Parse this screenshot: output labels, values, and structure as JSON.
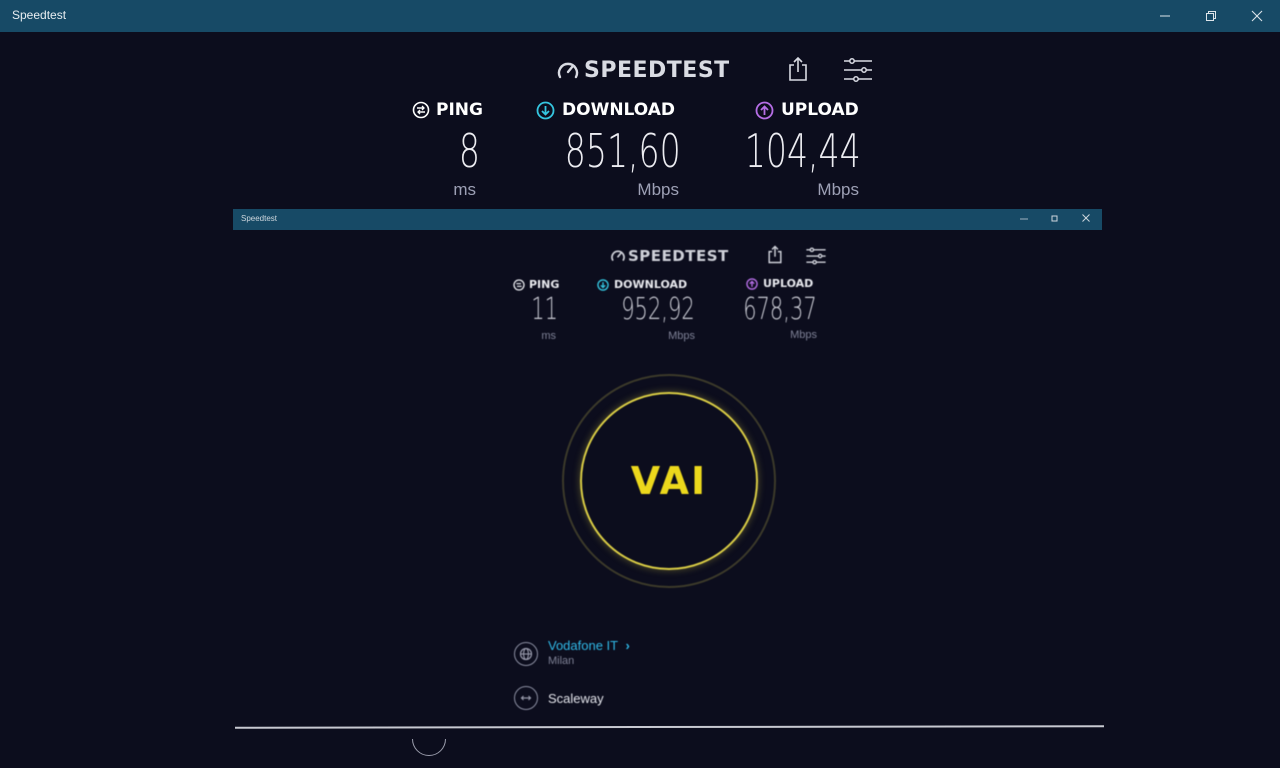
{
  "window": {
    "title": "Speedtest",
    "titlebar_color": "#174a66",
    "controls": [
      "minimize-icon",
      "restore-icon",
      "close-icon"
    ]
  },
  "header": {
    "logo_text": "SPEEDTEST",
    "share_icon": "share-icon",
    "settings_icon": "settings-sliders-icon"
  },
  "results": {
    "ping": {
      "label": "PING",
      "value": "8",
      "unit": "ms",
      "icon": "ping-icon",
      "color": "#ffffff"
    },
    "download": {
      "label": "DOWNLOAD",
      "value": "851,60",
      "unit": "Mbps",
      "icon": "download-arrow-icon",
      "color": "#35c6e0"
    },
    "upload": {
      "label": "UPLOAD",
      "value": "104,44",
      "unit": "Mbps",
      "icon": "upload-arrow-icon",
      "color": "#b66ee6"
    }
  },
  "inner": {
    "window_title": "Speedtest",
    "logo_text": "SPEEDTEST",
    "ping": {
      "label": "PING",
      "value": "11",
      "unit": "ms"
    },
    "download": {
      "label": "DOWNLOAD",
      "value": "952,92",
      "unit": "Mbps"
    },
    "upload": {
      "label": "UPLOAD",
      "value": "678,37",
      "unit": "Mbps"
    },
    "go_button": {
      "label": "VAI",
      "color": "#ecd81c"
    },
    "isp": {
      "name": "Vodafone IT",
      "location": "Milan",
      "icon": "globe-icon"
    },
    "server": {
      "name": "Scaleway",
      "icon": "server-arrows-icon"
    }
  }
}
